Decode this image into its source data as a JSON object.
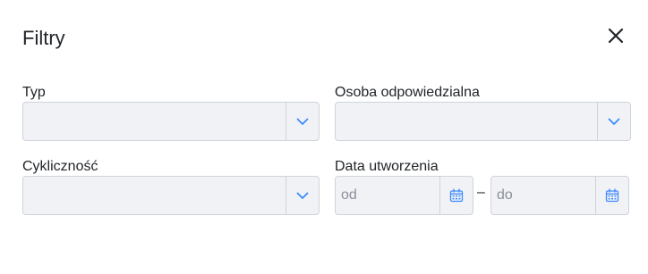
{
  "dialog": {
    "title": "Filtry",
    "close_icon": "close-icon"
  },
  "fields": {
    "type": {
      "label": "Typ",
      "value": "",
      "icon": "chevron-down-icon"
    },
    "responsible_person": {
      "label": "Osoba odpowiedzialna",
      "value": "",
      "icon": "chevron-down-icon"
    },
    "recurrence": {
      "label": "Cykliczność",
      "value": "",
      "icon": "chevron-down-icon"
    },
    "created_date": {
      "label": "Data utworzenia",
      "from_placeholder": "od",
      "to_placeholder": "do",
      "separator": "–",
      "icon": "calendar-icon"
    }
  },
  "colors": {
    "accent": "#3d8bfd",
    "field_background": "#f1f2f6",
    "field_border": "#cfd3da",
    "text": "#212529",
    "placeholder": "#8a8f98"
  }
}
